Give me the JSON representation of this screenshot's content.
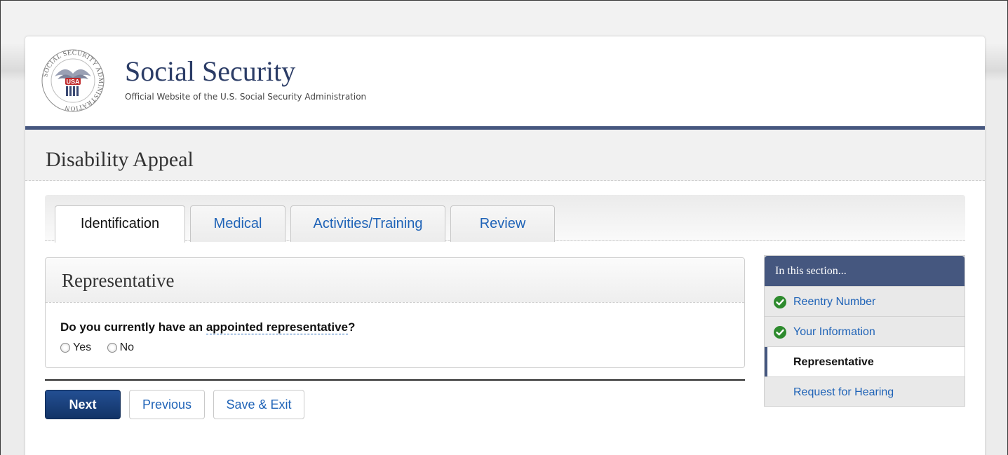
{
  "site": {
    "title": "Social Security",
    "subtitle": "Official Website of the U.S. Social Security Administration",
    "seal_text": "SOCIAL SECURITY ADMINISTRATION",
    "seal_badge": "USA"
  },
  "page": {
    "title": "Disability Appeal"
  },
  "tabs": [
    {
      "label": "Identification",
      "active": true
    },
    {
      "label": "Medical",
      "active": false
    },
    {
      "label": "Activities/Training",
      "active": false
    },
    {
      "label": "Review",
      "active": false
    }
  ],
  "section": {
    "title": "Representative",
    "question_prefix": "Do you currently have an ",
    "question_term": "appointed representative",
    "question_suffix": "?",
    "options": [
      {
        "label": "Yes",
        "checked": false
      },
      {
        "label": "No",
        "checked": false
      }
    ]
  },
  "buttons": {
    "next": "Next",
    "previous": "Previous",
    "save_exit": "Save & Exit"
  },
  "sidenav": {
    "heading": "In this section...",
    "items": [
      {
        "label": "Reentry Number",
        "status": "complete"
      },
      {
        "label": "Your Information",
        "status": "complete"
      },
      {
        "label": "Representative",
        "status": "current"
      },
      {
        "label": "Request for Hearing",
        "status": "pending"
      }
    ]
  },
  "colors": {
    "brand_navy": "#45577f",
    "link_blue": "#1f63b7",
    "check_green": "#2e8b2e",
    "primary_button": "#173f7e"
  },
  "icons": {
    "complete": "check-circle-icon",
    "seal": "ssa-seal-logo"
  }
}
